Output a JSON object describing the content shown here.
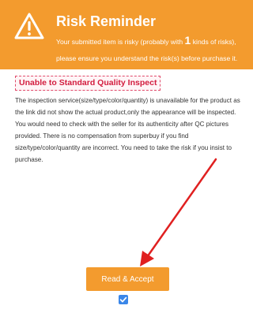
{
  "header": {
    "title": "Risk Reminder",
    "msg_pre": "Your submitted item is risky (probably with ",
    "msg_count": "1",
    "msg_post": " kinds of risks), please ensure you understand the risk(s) before purchase it.",
    "icon": "warning-icon"
  },
  "notice": {
    "tag": "Unable to Standard Quality Inspect",
    "description": "The inspection service(size/type/color/quantity) is unavailable for the product as the link did not show the actual product,only the appearance will be inspected. You would need to check with the seller for its authenticity after QC pictures provided. There is no compensation from superbuy if you find size/type/color/quantity are incorrect. You need to take the risk if you insist to purchase."
  },
  "footer": {
    "accept_label": "Read & Accept",
    "checkbox_checked": true
  },
  "colors": {
    "accent": "#f39b2e",
    "tag_text": "#d21c3e",
    "arrow": "#e02020",
    "checkbox": "#3a86e8"
  }
}
